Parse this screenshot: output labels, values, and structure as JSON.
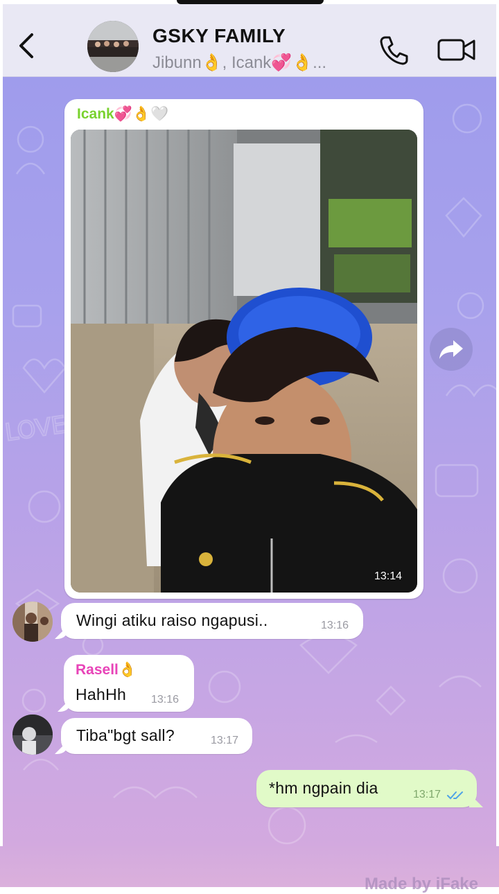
{
  "header": {
    "title": "GSKY FAMILY",
    "subtitle": "Jibunn👌, Icank💞👌...",
    "back_icon": "chevron-left-icon",
    "call_icon": "phone-icon",
    "video_icon": "video-camera-icon"
  },
  "photo_message": {
    "sender": "Icank💞👌🤍",
    "sender_color": "#7ad230",
    "time": "13:14"
  },
  "messages": [
    {
      "text": "Wingi atiku raiso ngapusi..",
      "time": "13:16"
    },
    {
      "sender": "Rasell👌",
      "sender_color": "#e844b8",
      "text": "HahHh",
      "time": "13:16"
    },
    {
      "text": "Tiba\"bgt sall?",
      "time": "13:17"
    },
    {
      "text": "*hm ngpain dia",
      "time": "13:17",
      "status": "read"
    }
  ],
  "watermark": "Made by iFake",
  "colors": {
    "header_bg": "#e9e8f4",
    "out_bubble": "#e1fac8",
    "read_ticks": "#4fa3e6"
  }
}
